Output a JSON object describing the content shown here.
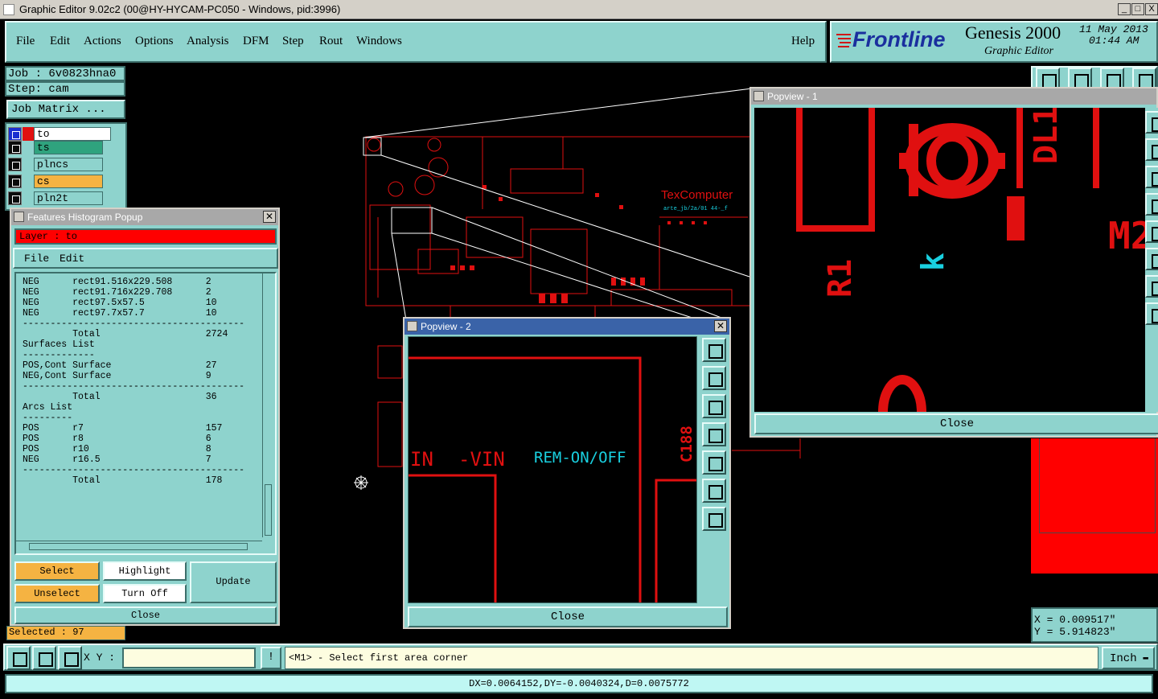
{
  "window": {
    "title": "Graphic Editor 9.02c2 (00@HY-HYCAM-PC050 - Windows, pid:3996)",
    "buttons": [
      "_",
      "□",
      "X"
    ]
  },
  "menu": {
    "items": [
      "File",
      "Edit",
      "Actions",
      "Options",
      "Analysis",
      "DFM",
      "Step",
      "Rout",
      "Windows"
    ],
    "help": "Help"
  },
  "brand": {
    "logo": "Frontline",
    "product": "Genesis 2000",
    "subtitle": "Graphic Editor",
    "date": "11 May 2013",
    "time": "01:44 AM"
  },
  "job": {
    "job_label": "Job : 6v0823hna0",
    "step_label": "Step: cam",
    "matrix_button": "Job Matrix ..."
  },
  "layers": [
    {
      "name": "to",
      "color": "#ffffff"
    },
    {
      "name": "ts",
      "color": "#2fa37e"
    },
    {
      "name": "plncs",
      "color": "#8ed3cd"
    },
    {
      "name": "cs",
      "color": "#f5b342"
    },
    {
      "name": "pln2t",
      "color": "#8ed3cd"
    }
  ],
  "histogram": {
    "title": "Features Histogram Popup",
    "layer_label": "Layer :  to",
    "menu": [
      "File",
      "Edit"
    ],
    "lines": [
      "NEG      rect91.516x229.508      2",
      "NEG      rect91.716x229.708      2",
      "NEG      rect97.5x57.5           10",
      "NEG      rect97.7x57.7           10",
      "----------------------------------------",
      "         Total                   2724",
      "",
      "Surfaces List",
      "-------------",
      "",
      "POS,Cont Surface                 27",
      "NEG,Cont Surface                 9",
      "----------------------------------------",
      "         Total                   36",
      "",
      "Arcs List",
      "---------",
      "",
      "POS      r7                      157",
      "POS      r8                      6",
      "POS      r10                     8",
      "NEG      r16.5                   7",
      "----------------------------------------",
      "         Total                   178"
    ],
    "buttons": {
      "select": "Select",
      "unselect": "Unselect",
      "highlight": "Highlight",
      "turn_off": "Turn Off",
      "update": "Update",
      "close": "Close"
    }
  },
  "selected": "Selected : 97",
  "popview1": {
    "title": "Popview - 1",
    "close": "Close",
    "labels": [
      "DL1",
      "R1",
      "k",
      "M2"
    ]
  },
  "popview2": {
    "title": "Popview - 2",
    "close": "Close",
    "labels": [
      "IN",
      "-VIN",
      "REM-ON/OFF",
      "C188"
    ]
  },
  "board": {
    "brand_text": "TexComputer",
    "small_text": "arte_jb/2a/01 44-_f"
  },
  "coords": {
    "x": "X = 0.009517\"",
    "y": "Y = 5.914823\""
  },
  "bottom": {
    "xy_label": "X Y :",
    "xy_value": "",
    "info_button": "!",
    "prompt": "<M1> - Select first area corner",
    "units": "Inch",
    "status": "DX=0.0064152,DY=-0.0040324,D=0.0075772"
  },
  "colors": {
    "panel": "#8ed3cd",
    "trace": "#e01010",
    "annotation": "#19d0e0",
    "selected_layer": "#2fa37e",
    "active_button": "#f5b342",
    "popup_title": "#3a63a8"
  }
}
